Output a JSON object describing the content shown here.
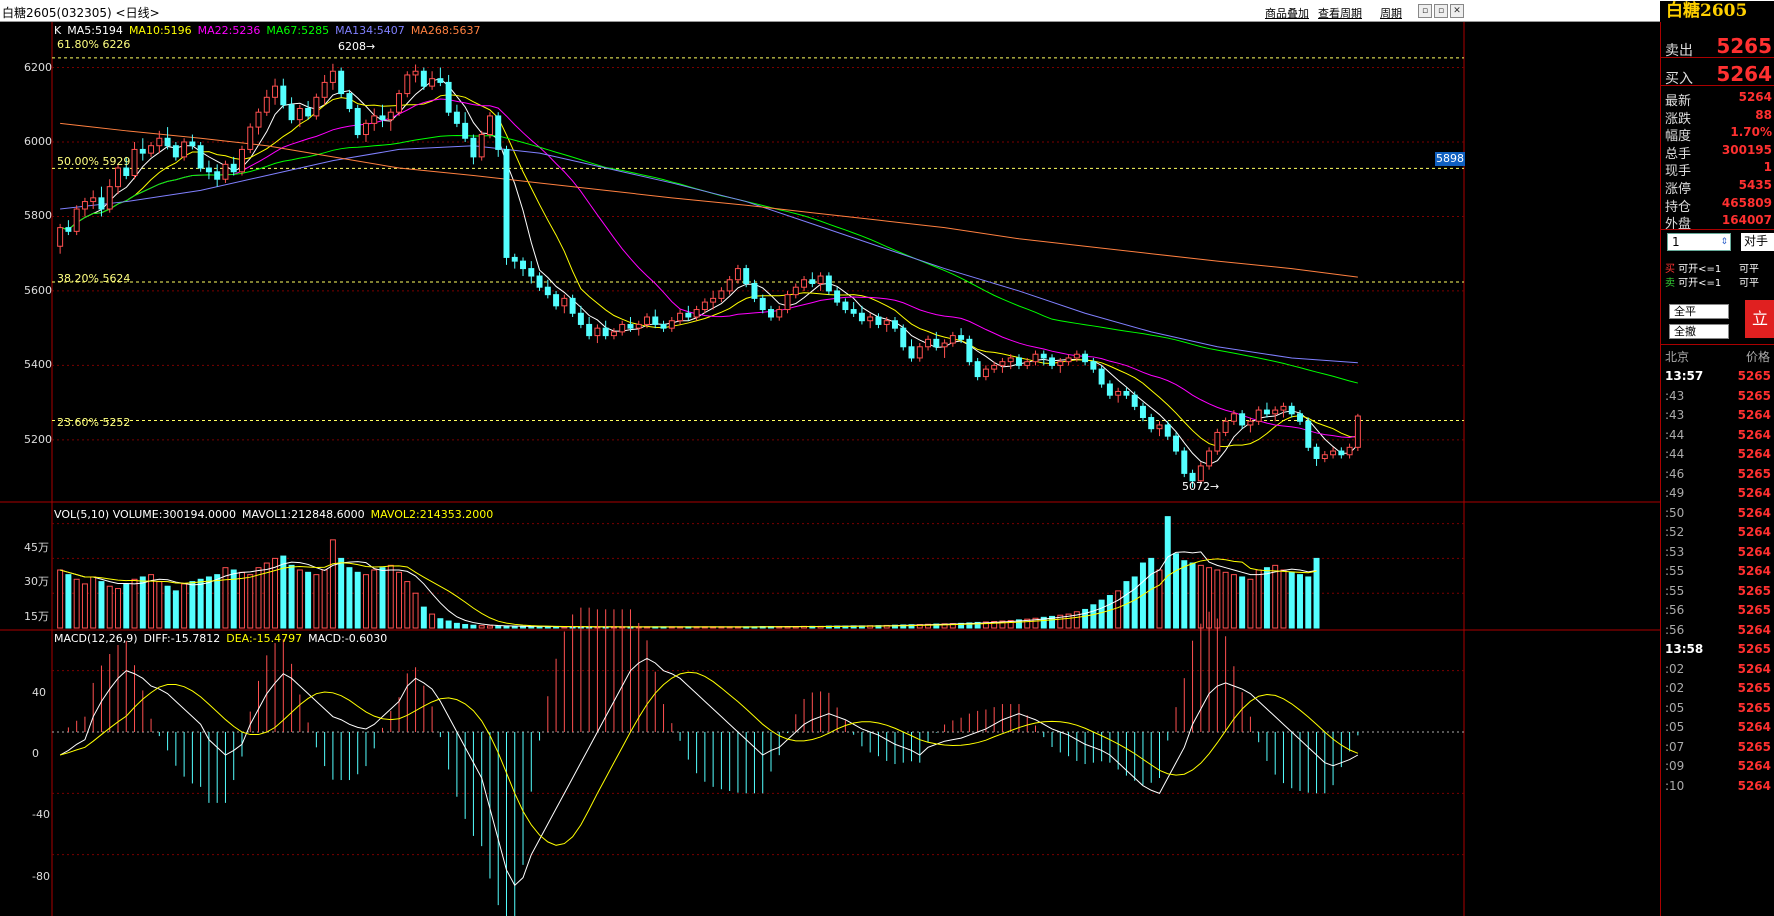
{
  "header": {
    "title": "白糖2605(032305) <日线>",
    "links": [
      "商品叠加",
      "查看周期",
      "周期"
    ],
    "brand": "白糖2605"
  },
  "chart": {
    "ma_legend": [
      {
        "text": "K",
        "color": "#ffffff"
      },
      {
        "text": "MA5:5194",
        "color": "#ffffff"
      },
      {
        "text": "MA10:5196",
        "color": "#ffff00"
      },
      {
        "text": "MA22:5236",
        "color": "#ff00ff"
      },
      {
        "text": "MA67:5285",
        "color": "#00ff00"
      },
      {
        "text": "MA134:5407",
        "color": "#8080ff"
      },
      {
        "text": "MA268:5637",
        "color": "#ff8040"
      }
    ],
    "fib_labels": [
      "61.80% 6226",
      "50.00% 5929",
      "38.20% 5624",
      "23.60% 5252"
    ],
    "price_ticks": [
      "6200",
      "6000",
      "5800",
      "5600",
      "5400",
      "5200"
    ],
    "high_mark": "6208",
    "low_mark": "5072",
    "right_badge": "5898",
    "vol_legend": [
      {
        "text": "VOL(5,10) VOLUME:300194.0000",
        "color": "#ffffff"
      },
      {
        "text": "MAVOL1:212848.6000",
        "color": "#ffffff"
      },
      {
        "text": "MAVOL2:214353.2000",
        "color": "#ffff00"
      }
    ],
    "vol_ticks": [
      "45万",
      "30万",
      "15万"
    ],
    "macd_legend": [
      {
        "text": "MACD(12,26,9)",
        "color": "#ffffff"
      },
      {
        "text": "DIFF:-15.7812",
        "color": "#ffffff"
      },
      {
        "text": "DEA:-15.4797",
        "color": "#ffff00"
      },
      {
        "text": "MACD:-0.6030",
        "color": "#ffffff"
      }
    ],
    "macd_ticks": [
      "40",
      "0",
      "-40",
      "-80"
    ]
  },
  "quote": {
    "sell_label": "卖出",
    "sell_value": "5265",
    "buy_label": "买入",
    "buy_value": "5264",
    "stats": [
      {
        "k": "最新",
        "v": "5264"
      },
      {
        "k": "涨跌",
        "v": "88"
      },
      {
        "k": "幅度",
        "v": "1.70%"
      },
      {
        "k": "总手",
        "v": "300195"
      },
      {
        "k": "现手",
        "v": "1"
      },
      {
        "k": "涨停",
        "v": "5435"
      },
      {
        "k": "持仓",
        "v": "465809"
      },
      {
        "k": "外盘",
        "v": "164007"
      }
    ],
    "qty_value": "1",
    "opp_label": "对手",
    "buy_open": "买 可开<=1",
    "buy_close": "可平",
    "sell_open": "卖 可开<=1",
    "sell_close": "可平",
    "btn_closeall": "全平",
    "btn_cancelall": "全撤",
    "btn_order": "立",
    "ticks_header_left": "北京",
    "ticks_header_right": "价格",
    "ticks": [
      {
        "t": "13:57",
        "p": "5265"
      },
      {
        "t": ":43",
        "p": "5265"
      },
      {
        "t": ":43",
        "p": "5264"
      },
      {
        "t": ":44",
        "p": "5264"
      },
      {
        "t": ":44",
        "p": "5264"
      },
      {
        "t": ":46",
        "p": "5265"
      },
      {
        "t": ":49",
        "p": "5264"
      },
      {
        "t": ":50",
        "p": "5264"
      },
      {
        "t": ":52",
        "p": "5264"
      },
      {
        "t": ":53",
        "p": "5264"
      },
      {
        "t": ":55",
        "p": "5264"
      },
      {
        "t": ":55",
        "p": "5265"
      },
      {
        "t": ":56",
        "p": "5265"
      },
      {
        "t": ":56",
        "p": "5264"
      },
      {
        "t": "13:58",
        "p": "5265"
      },
      {
        "t": ":02",
        "p": "5264"
      },
      {
        "t": ":02",
        "p": "5265"
      },
      {
        "t": ":05",
        "p": "5265"
      },
      {
        "t": ":05",
        "p": "5264"
      },
      {
        "t": ":07",
        "p": "5265"
      },
      {
        "t": ":09",
        "p": "5264"
      },
      {
        "t": ":10",
        "p": "5264"
      }
    ]
  },
  "chart_data": {
    "type": "candlestick",
    "price_range": [
      5060,
      6290
    ],
    "candles": [
      [
        5720,
        5780,
        5700,
        5770
      ],
      [
        5770,
        5790,
        5750,
        5760
      ],
      [
        5760,
        5830,
        5750,
        5820
      ],
      [
        5820,
        5850,
        5800,
        5840
      ],
      [
        5840,
        5870,
        5820,
        5850
      ],
      [
        5850,
        5880,
        5800,
        5820
      ],
      [
        5820,
        5900,
        5810,
        5880
      ],
      [
        5880,
        5940,
        5860,
        5930
      ],
      [
        5930,
        5960,
        5900,
        5910
      ],
      [
        5910,
        6000,
        5900,
        5980
      ],
      [
        5980,
        6010,
        5950,
        5970
      ],
      [
        5970,
        6000,
        5960,
        5990
      ],
      [
        5990,
        6030,
        5970,
        6010
      ],
      [
        6010,
        6040,
        5980,
        5990
      ],
      [
        5990,
        6000,
        5950,
        5960
      ],
      [
        5960,
        6010,
        5950,
        6000
      ],
      [
        6000,
        6020,
        5980,
        5990
      ],
      [
        5990,
        6000,
        5920,
        5930
      ],
      [
        5930,
        5950,
        5900,
        5920
      ],
      [
        5920,
        5940,
        5880,
        5900
      ],
      [
        5900,
        5950,
        5890,
        5940
      ],
      [
        5940,
        5960,
        5910,
        5920
      ],
      [
        5920,
        5990,
        5910,
        5980
      ],
      [
        5980,
        6050,
        5970,
        6040
      ],
      [
        6040,
        6090,
        6020,
        6080
      ],
      [
        6080,
        6140,
        6070,
        6120
      ],
      [
        6120,
        6170,
        6100,
        6150
      ],
      [
        6150,
        6170,
        6090,
        6100
      ],
      [
        6100,
        6120,
        6050,
        6060
      ],
      [
        6060,
        6100,
        6040,
        6090
      ],
      [
        6090,
        6110,
        6060,
        6070
      ],
      [
        6070,
        6130,
        6060,
        6120
      ],
      [
        6120,
        6180,
        6100,
        6160
      ],
      [
        6160,
        6210,
        6140,
        6190
      ],
      [
        6190,
        6200,
        6120,
        6130
      ],
      [
        6130,
        6140,
        6080,
        6090
      ],
      [
        6090,
        6100,
        6010,
        6020
      ],
      [
        6020,
        6060,
        6000,
        6050
      ],
      [
        6050,
        6090,
        6030,
        6070
      ],
      [
        6070,
        6100,
        6040,
        6060
      ],
      [
        6060,
        6090,
        6030,
        6080
      ],
      [
        6080,
        6140,
        6070,
        6130
      ],
      [
        6130,
        6190,
        6120,
        6180
      ],
      [
        6180,
        6208,
        6160,
        6190
      ],
      [
        6190,
        6200,
        6140,
        6150
      ],
      [
        6150,
        6190,
        6140,
        6170
      ],
      [
        6170,
        6200,
        6150,
        6160
      ],
      [
        6160,
        6180,
        6070,
        6080
      ],
      [
        6080,
        6100,
        6040,
        6050
      ],
      [
        6050,
        6080,
        6000,
        6010
      ],
      [
        6010,
        6020,
        5940,
        5960
      ],
      [
        5960,
        6030,
        5950,
        6020
      ],
      [
        6020,
        6080,
        6010,
        6070
      ],
      [
        6070,
        6080,
        5960,
        5980
      ],
      [
        5980,
        5990,
        5670,
        5690
      ],
      [
        5690,
        5700,
        5660,
        5680
      ],
      [
        5680,
        5690,
        5640,
        5660
      ],
      [
        5660,
        5680,
        5620,
        5640
      ],
      [
        5640,
        5650,
        5600,
        5610
      ],
      [
        5610,
        5630,
        5580,
        5590
      ],
      [
        5590,
        5600,
        5550,
        5560
      ],
      [
        5560,
        5590,
        5540,
        5580
      ],
      [
        5580,
        5590,
        5530,
        5540
      ],
      [
        5540,
        5560,
        5500,
        5510
      ],
      [
        5510,
        5530,
        5470,
        5480
      ],
      [
        5480,
        5510,
        5460,
        5500
      ],
      [
        5500,
        5520,
        5470,
        5480
      ],
      [
        5480,
        5500,
        5470,
        5490
      ],
      [
        5490,
        5520,
        5480,
        5510
      ],
      [
        5510,
        5530,
        5490,
        5500
      ],
      [
        5500,
        5520,
        5480,
        5510
      ],
      [
        5510,
        5540,
        5500,
        5530
      ],
      [
        5530,
        5550,
        5500,
        5510
      ],
      [
        5510,
        5520,
        5490,
        5500
      ],
      [
        5500,
        5530,
        5490,
        5520
      ],
      [
        5520,
        5550,
        5510,
        5540
      ],
      [
        5540,
        5560,
        5520,
        5530
      ],
      [
        5530,
        5560,
        5520,
        5550
      ],
      [
        5550,
        5580,
        5540,
        5570
      ],
      [
        5570,
        5600,
        5550,
        5580
      ],
      [
        5580,
        5610,
        5570,
        5600
      ],
      [
        5600,
        5640,
        5590,
        5630
      ],
      [
        5630,
        5670,
        5620,
        5660
      ],
      [
        5660,
        5670,
        5610,
        5620
      ],
      [
        5620,
        5630,
        5570,
        5580
      ],
      [
        5580,
        5590,
        5540,
        5550
      ],
      [
        5550,
        5560,
        5520,
        5530
      ],
      [
        5530,
        5560,
        5520,
        5550
      ],
      [
        5550,
        5600,
        5540,
        5590
      ],
      [
        5590,
        5620,
        5580,
        5610
      ],
      [
        5610,
        5640,
        5600,
        5630
      ],
      [
        5630,
        5650,
        5610,
        5620
      ],
      [
        5620,
        5650,
        5600,
        5640
      ],
      [
        5640,
        5650,
        5590,
        5600
      ],
      [
        5600,
        5610,
        5560,
        5570
      ],
      [
        5570,
        5580,
        5540,
        5550
      ],
      [
        5550,
        5570,
        5530,
        5540
      ],
      [
        5540,
        5560,
        5510,
        5520
      ],
      [
        5520,
        5540,
        5500,
        5530
      ],
      [
        5530,
        5540,
        5500,
        5510
      ],
      [
        5510,
        5530,
        5490,
        5520
      ],
      [
        5520,
        5530,
        5490,
        5500
      ],
      [
        5500,
        5510,
        5440,
        5450
      ],
      [
        5450,
        5470,
        5410,
        5420
      ],
      [
        5420,
        5460,
        5410,
        5450
      ],
      [
        5450,
        5480,
        5440,
        5470
      ],
      [
        5470,
        5490,
        5440,
        5450
      ],
      [
        5450,
        5470,
        5420,
        5460
      ],
      [
        5460,
        5490,
        5450,
        5480
      ],
      [
        5480,
        5500,
        5460,
        5470
      ],
      [
        5470,
        5480,
        5400,
        5410
      ],
      [
        5410,
        5420,
        5360,
        5370
      ],
      [
        5370,
        5400,
        5360,
        5390
      ],
      [
        5390,
        5410,
        5380,
        5400
      ],
      [
        5400,
        5420,
        5380,
        5410
      ],
      [
        5410,
        5430,
        5390,
        5420
      ],
      [
        5420,
        5430,
        5390,
        5400
      ],
      [
        5400,
        5420,
        5390,
        5410
      ],
      [
        5410,
        5440,
        5400,
        5430
      ],
      [
        5430,
        5440,
        5400,
        5420
      ],
      [
        5420,
        5430,
        5390,
        5400
      ],
      [
        5400,
        5420,
        5380,
        5410
      ],
      [
        5410,
        5430,
        5400,
        5420
      ],
      [
        5420,
        5440,
        5410,
        5430
      ],
      [
        5430,
        5440,
        5400,
        5410
      ],
      [
        5410,
        5420,
        5380,
        5390
      ],
      [
        5390,
        5400,
        5340,
        5350
      ],
      [
        5350,
        5360,
        5310,
        5320
      ],
      [
        5320,
        5340,
        5300,
        5330
      ],
      [
        5330,
        5340,
        5310,
        5320
      ],
      [
        5320,
        5330,
        5280,
        5290
      ],
      [
        5290,
        5300,
        5250,
        5260
      ],
      [
        5260,
        5270,
        5220,
        5230
      ],
      [
        5230,
        5250,
        5210,
        5240
      ],
      [
        5240,
        5250,
        5200,
        5210
      ],
      [
        5210,
        5220,
        5160,
        5170
      ],
      [
        5170,
        5180,
        5100,
        5110
      ],
      [
        5110,
        5120,
        5072,
        5090
      ],
      [
        5090,
        5140,
        5080,
        5130
      ],
      [
        5130,
        5180,
        5120,
        5170
      ],
      [
        5170,
        5230,
        5160,
        5220
      ],
      [
        5220,
        5260,
        5210,
        5250
      ],
      [
        5250,
        5280,
        5240,
        5270
      ],
      [
        5270,
        5280,
        5230,
        5240
      ],
      [
        5240,
        5260,
        5220,
        5250
      ],
      [
        5250,
        5290,
        5240,
        5280
      ],
      [
        5280,
        5300,
        5260,
        5270
      ],
      [
        5270,
        5290,
        5250,
        5280
      ],
      [
        5280,
        5300,
        5260,
        5290
      ],
      [
        5290,
        5300,
        5260,
        5270
      ],
      [
        5270,
        5280,
        5240,
        5250
      ],
      [
        5250,
        5260,
        5170,
        5180
      ],
      [
        5180,
        5190,
        5130,
        5150
      ],
      [
        5150,
        5170,
        5140,
        5160
      ],
      [
        5160,
        5180,
        5150,
        5170
      ],
      [
        5170,
        5180,
        5150,
        5160
      ],
      [
        5160,
        5190,
        5150,
        5180
      ],
      [
        5180,
        5270,
        5170,
        5264
      ]
    ],
    "volume_range": [
      0,
      500000
    ],
    "volume": [
      250000,
      230000,
      210000,
      190000,
      220000,
      200000,
      180000,
      170000,
      190000,
      210000,
      220000,
      230000,
      200000,
      180000,
      160000,
      190000,
      200000,
      210000,
      220000,
      230000,
      260000,
      250000,
      240000,
      230000,
      260000,
      280000,
      300000,
      310000,
      270000,
      250000,
      240000,
      230000,
      250000,
      380000,
      300000,
      260000,
      240000,
      230000,
      250000,
      260000,
      270000,
      240000,
      200000,
      150000,
      90000,
      60000,
      40000,
      30000,
      20000,
      15000,
      12000,
      10000,
      9000,
      8000,
      8000,
      7000,
      7000,
      6000,
      6000,
      6000,
      5000,
      5000,
      5000,
      5000,
      5000,
      5000,
      5000,
      5000,
      5000,
      5000,
      5000,
      5000,
      5000,
      5000,
      5000,
      5000,
      5000,
      5000,
      5000,
      5000,
      5000,
      5000,
      5000,
      5000,
      5000,
      6000,
      6000,
      6000,
      6000,
      6000,
      7000,
      7000,
      7000,
      8000,
      8000,
      8000,
      9000,
      9000,
      10000,
      10000,
      11000,
      12000,
      13000,
      14000,
      15000,
      16000,
      17000,
      18000,
      19000,
      20000,
      22000,
      24000,
      26000,
      28000,
      30000,
      32000,
      35000,
      38000,
      42000,
      46000,
      50000,
      55000,
      60000,
      70000,
      80000,
      100000,
      120000,
      140000,
      160000,
      200000,
      220000,
      280000,
      300000,
      250000,
      480000,
      320000,
      290000,
      280000,
      270000,
      260000,
      250000,
      240000,
      230000,
      220000,
      210000,
      250000,
      260000,
      270000,
      250000,
      240000,
      230000,
      220000,
      300000
    ],
    "macd_range": [
      -120,
      60
    ],
    "macd": [
      -15,
      -12,
      -8,
      -5,
      10,
      20,
      28,
      35,
      40,
      38,
      35,
      30,
      28,
      25,
      20,
      15,
      10,
      5,
      -5,
      -10,
      -15,
      -12,
      -8,
      5,
      15,
      25,
      32,
      38,
      35,
      30,
      25,
      20,
      15,
      10,
      8,
      5,
      3,
      2,
      5,
      10,
      15,
      20,
      30,
      35,
      32,
      28,
      20,
      10,
      0,
      -10,
      -20,
      -30,
      -50,
      -70,
      -90,
      -100,
      -95,
      -80,
      -70,
      -60,
      -50,
      -40,
      -30,
      -20,
      -10,
      0,
      10,
      20,
      30,
      40,
      45,
      48,
      45,
      40,
      38,
      35,
      30,
      25,
      20,
      15,
      10,
      5,
      0,
      -5,
      -10,
      -15,
      -12,
      -10,
      -5,
      0,
      5,
      8,
      10,
      12,
      10,
      8,
      5,
      2,
      0,
      -2,
      -5,
      -8,
      -10,
      -12,
      -15,
      -10,
      -8,
      -6,
      -5,
      -4,
      -2,
      0,
      2,
      5,
      8,
      10,
      12,
      10,
      8,
      5,
      2,
      0,
      -2,
      -5,
      -8,
      -10,
      -12,
      -15,
      -20,
      -25,
      -30,
      -35,
      -38,
      -40,
      -30,
      -20,
      -10,
      5,
      15,
      25,
      30,
      32,
      30,
      28,
      25,
      20,
      15,
      10,
      5,
      0,
      -5,
      -10,
      -15,
      -20,
      -22,
      -20,
      -18,
      -15,
      -12,
      -8,
      -5
    ]
  }
}
